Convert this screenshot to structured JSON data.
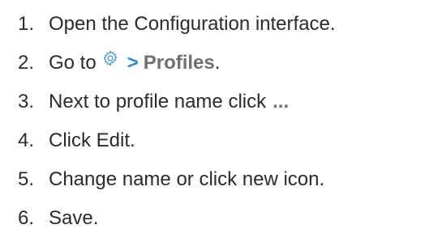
{
  "steps": [
    {
      "number": "1.",
      "text": "Open the Configuration interface."
    },
    {
      "number": "2.",
      "text_before": "Go to",
      "icon": "gear-icon",
      "arrow": ">",
      "target": "Profiles",
      "suffix": "."
    },
    {
      "number": "3.",
      "text": "Next to profile name click",
      "dots": "..."
    },
    {
      "number": "4.",
      "text": "Click Edit."
    },
    {
      "number": "5.",
      "text": "Change name or click new icon."
    },
    {
      "number": "6.",
      "text": "Save."
    }
  ],
  "colors": {
    "text": "#2b2b2b",
    "accent": "#2b8be0",
    "muted": "#707070"
  }
}
